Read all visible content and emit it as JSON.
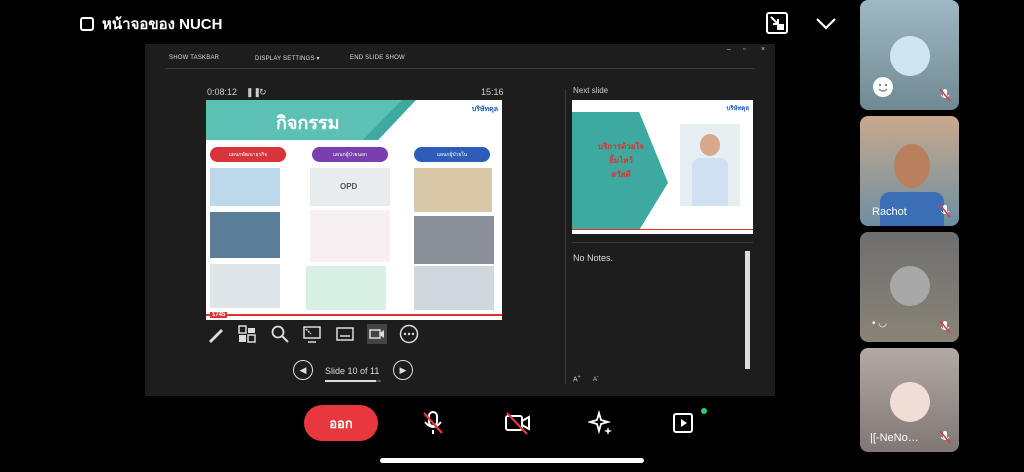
{
  "header": {
    "title": "หน้าจอของ NUCH"
  },
  "presenter": {
    "toolbar": {
      "show_taskbar": "SHOW TASKBAR",
      "display_settings": "DISPLAY SETTINGS ▾",
      "end_slide_show": "END SLIDE SHOW"
    },
    "elapsed_time": "0:08:12",
    "clock": "15:16",
    "current_slide": {
      "title": "กิจกรรม",
      "logo_text": "บริษัทดุล",
      "pills": [
        "แผนกพัฒนาธุรกิจ",
        "แผนกผู้ป่วยนอก",
        "แผนกผู้ป่วยใน"
      ],
      "pill_colors": [
        "#d7343b",
        "#7a3fae",
        "#2d5db8"
      ],
      "image_labels": [
        "OPD"
      ],
      "footer_tag": "1745"
    },
    "slide_counter": "Slide 10 of 11",
    "slide_progress": 0.91,
    "next_slide_label": "Next slide",
    "next_slide": {
      "text_line1": "บริการด้วยใจ",
      "text_line2": "ยิ้มไหว้",
      "text_line3": "สวัสดี",
      "logo_text": "บริษัทดุล"
    },
    "notes_text": "No Notes.",
    "font_increase": "A",
    "font_decrease": "A"
  },
  "participants": [
    {
      "name": "",
      "mic": "muted"
    },
    {
      "name": "Rachot",
      "mic": "muted"
    },
    {
      "name": "",
      "mic": "muted"
    },
    {
      "name": "|[-NeNo…",
      "mic": "muted"
    }
  ],
  "controls": {
    "leave_label": "ออก"
  },
  "colors": {
    "leave": "#e8373f",
    "teal": "#3ea9a0",
    "mute_red": "#e8373f",
    "online_dot": "#2ecc71"
  }
}
